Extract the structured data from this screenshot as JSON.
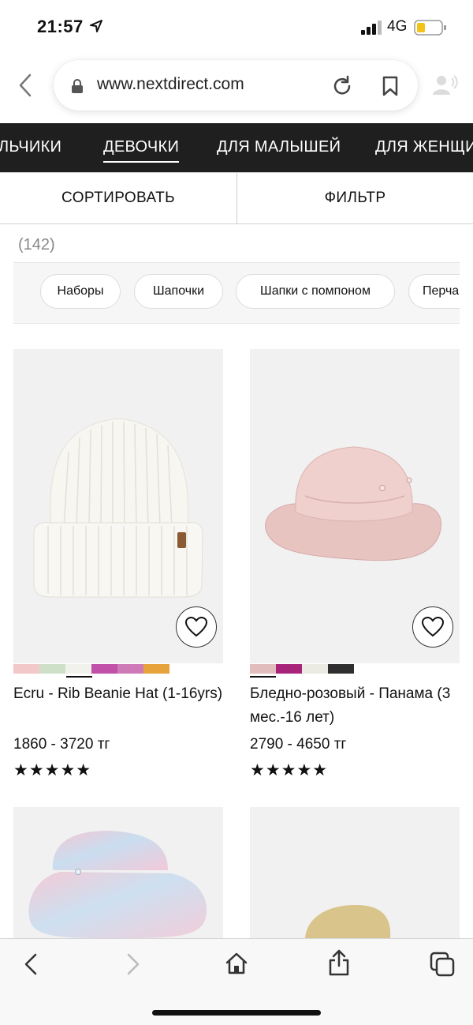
{
  "status": {
    "time": "21:57",
    "network": "4G"
  },
  "browser": {
    "url": "www.nextdirect.com"
  },
  "categories": {
    "items": [
      {
        "label": "ЛЬЧИКИ"
      },
      {
        "label": "ДЕВОЧКИ"
      },
      {
        "label": "ДЛЯ МАЛЫШЕЙ"
      },
      {
        "label": "ДЛЯ ЖЕНЩИ"
      }
    ],
    "active": "ДЕВОЧКИ"
  },
  "controls": {
    "sort_label": "СОРТИРОВАТЬ",
    "filter_label": "ФИЛЬТР"
  },
  "results": {
    "count": "(142)"
  },
  "chips": [
    {
      "label": "Наборы"
    },
    {
      "label": "Шапочки"
    },
    {
      "label": "Шапки с помпоном"
    },
    {
      "label": "Перча"
    }
  ],
  "products": [
    {
      "name": "Ecru - Rib Beanie Hat (1-16yrs)",
      "price": "1860 - 3720 тг",
      "rating_stars": "★★★★★",
      "rating": 5,
      "swatches": [
        "#f3c8c8",
        "#cfe0c8",
        "#f2f2ec",
        "#c050a8",
        "#cf7ab8",
        "#e8a23c"
      ]
    },
    {
      "name": "Бледно-розовый - Панама (3 мес.-16 лет)",
      "price": "2790 - 4650 тг",
      "rating_stars": "★★★★★",
      "rating": 5,
      "swatches": [
        "#e2bdbd",
        "#a8247a",
        "#ecebe3",
        "#2e2e2e"
      ]
    }
  ],
  "colors": {
    "nav_bg": "#1f1f1f",
    "accent": "#111111"
  }
}
